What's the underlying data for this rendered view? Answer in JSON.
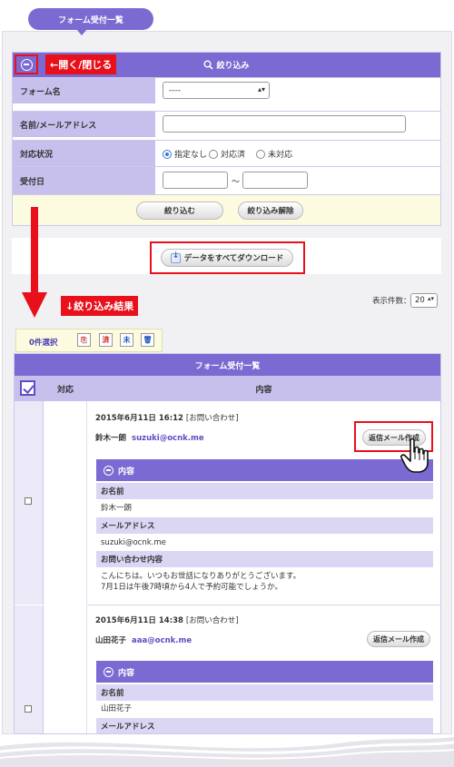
{
  "page": {
    "title": "フォーム受付一覧"
  },
  "filter": {
    "heading": "絞り込み",
    "toggle_annotation": "←開く/閉じる",
    "fields": [
      {
        "label": "フォーム名",
        "value": "----"
      },
      {
        "label": "名前/メールアドレス",
        "value": ""
      },
      {
        "label": "対応状況",
        "value": ""
      },
      {
        "label": "受付日",
        "value": ""
      }
    ],
    "status_options": [
      "指定なし",
      "対応済",
      "未対応"
    ],
    "status_selected": "指定なし",
    "date_separator": "〜",
    "apply_button": "絞り込む",
    "clear_button": "絞り込み解除"
  },
  "download": {
    "button": "データをすべてダウンロード"
  },
  "results": {
    "annotation": "↓絞り込み結果",
    "per_page_label": "表示件数：",
    "per_page_value": "20",
    "selected_count": "0件選択",
    "toolbar_icons": [
      "copy-icon",
      "done-icon",
      "pending-icon",
      "trash-icon"
    ],
    "toolbar_glyphs": [
      "⎘",
      "済",
      "未",
      "🗑"
    ]
  },
  "list": {
    "heading": "フォーム受付一覧",
    "col_status": "対応",
    "col_content": "内容",
    "reply_button": "返信メール作成",
    "detail_heading": "内容",
    "entries": [
      {
        "datetime": "2015年6月11日 16:12",
        "form": "[お問い合わせ]",
        "name": "鈴木一朗",
        "email": "suzuki@ocnk.me",
        "fields": [
          {
            "label": "お名前",
            "value": "鈴木一朗"
          },
          {
            "label": "メールアドレス",
            "value": "suzuki@ocnk.me"
          },
          {
            "label": "お問い合わせ内容",
            "value_lines": [
              "こんにちは。いつもお世話になりありがとうございます。",
              "7月1日は午後7時頃から4人で予約可能でしょうか。"
            ]
          }
        ]
      },
      {
        "datetime": "2015年6月11日 14:38",
        "form": "[お問い合わせ]",
        "name": "山田花子",
        "email": "aaa@ocnk.me",
        "fields": [
          {
            "label": "お名前",
            "value": "山田花子"
          },
          {
            "label": "メールアドレス",
            "value": ""
          }
        ]
      }
    ]
  },
  "colors": {
    "brand_purple": "#7b6ad2",
    "label_lavender": "#c7bfec",
    "annotation_red": "#e8101a",
    "button_yellow_bg": "#fcfbe0"
  }
}
